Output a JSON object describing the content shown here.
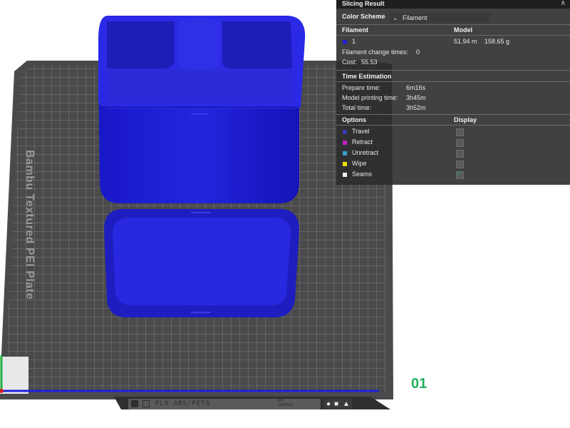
{
  "viewport": {
    "plate_brand": "Bambu Textured PEI Plate",
    "plate_number": "01",
    "plate_type_label": "PLA ABS/PETG",
    "surface_label_line1": "HOT",
    "surface_label_line2": "SURFACE",
    "model_color": "#1f1fd6",
    "bed_color": "#4a4a4c"
  },
  "panel": {
    "title": "Slicing Result",
    "color_scheme_label": "Color Scheme",
    "color_scheme_value": "Filament",
    "filament_header": "Filament",
    "model_header": "Model",
    "filament": {
      "id": "1",
      "color": "#2222cc",
      "length": "51.94 m",
      "weight": "158.65 g"
    },
    "filament_change_label": "Filament change times:",
    "filament_change_value": "0",
    "cost_label": "Cost:",
    "cost_value": "55.53",
    "time_header": "Time Estimation",
    "prepare_label": "Prepare time:",
    "prepare_value": "6m16s",
    "model_print_label": "Model printing time:",
    "model_print_value": "3h45m",
    "total_label": "Total time:",
    "total_value": "3h52m",
    "options_header": "Options",
    "display_header": "Display",
    "options": [
      {
        "label": "Travel",
        "color": "#3a3ab0",
        "checked": false
      },
      {
        "label": "Retract",
        "color": "#c020c0",
        "checked": false
      },
      {
        "label": "Unretract",
        "color": "#3aa0d0",
        "checked": false
      },
      {
        "label": "Wipe",
        "color": "#f0e010",
        "checked": false
      },
      {
        "label": "Seams",
        "color": "#f0f0f0",
        "checked": true
      }
    ]
  }
}
